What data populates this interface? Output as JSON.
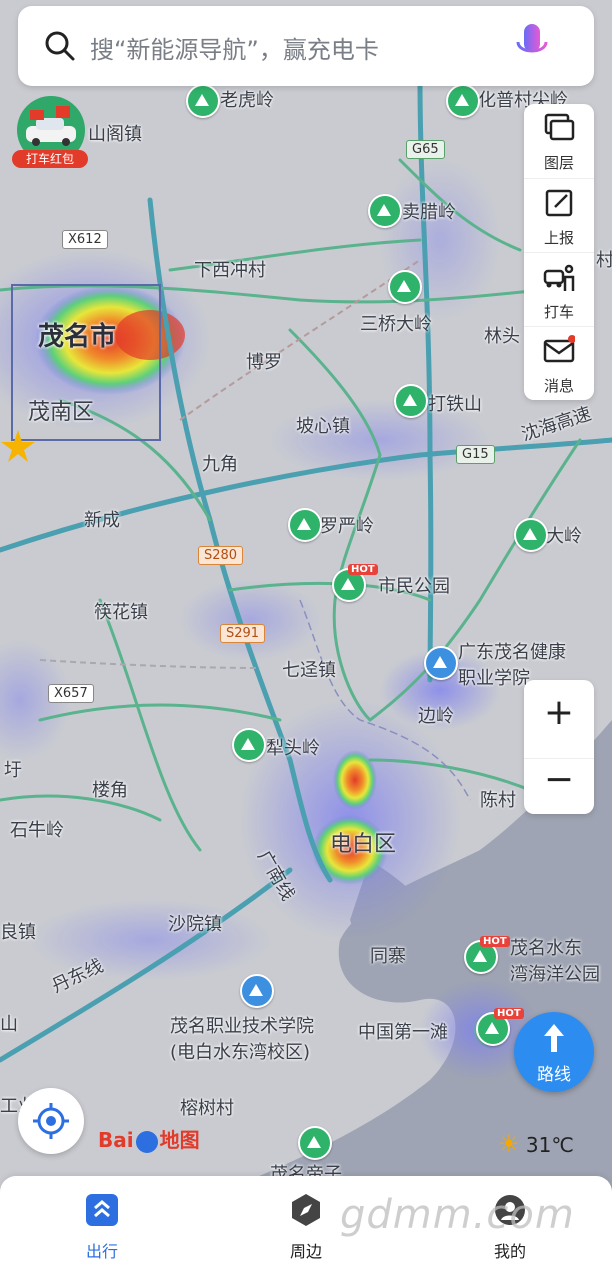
{
  "search": {
    "placeholder_text": "搜“新能源导航”，赢充电卡"
  },
  "redpack": {
    "label": "打车红包"
  },
  "tools": [
    {
      "label": "图层",
      "icon": "layers-icon"
    },
    {
      "label": "上报",
      "icon": "report-icon"
    },
    {
      "label": "打车",
      "icon": "taxi-icon"
    },
    {
      "label": "消息",
      "icon": "message-icon"
    }
  ],
  "zoom": {
    "in": "+",
    "out": "−"
  },
  "route": {
    "label": "路线"
  },
  "weather": {
    "temp": "31℃"
  },
  "logo": {
    "text": "Bai",
    "text2": "地图"
  },
  "watermark": "gdmm.com",
  "nav": [
    {
      "label": "出行",
      "icon": "travel-icon",
      "active": true
    },
    {
      "label": "周边",
      "icon": "compass-icon",
      "active": false
    },
    {
      "label": "我的",
      "icon": "profile-icon",
      "active": false
    }
  ],
  "map_labels": {
    "maoming": "茂名市",
    "maonan": "茂南区",
    "dianbai": "电白区",
    "laohuling": "老虎岭",
    "huapu": "化普村尖岭",
    "shange": "山阁镇",
    "maila": "卖腊岭",
    "xiaxichong": "下西冲村",
    "sanqiao": "三桥大岭",
    "linto": "林头",
    "cun": "村",
    "boluo": "博罗",
    "poxin": "坡心镇",
    "datie": "打铁山",
    "shenhai": "沈海高速",
    "jiujiao": "九角",
    "xincheng": "新成",
    "luoyan": "罗严岭",
    "shimin": "市民公园",
    "daling": "大岭",
    "kuaihua": "筷花镇",
    "qijing": "七迳镇",
    "gd_health": "广东茂名健康",
    "gd_health2": "职业学院",
    "bianling": "边岭",
    "xitou": "犁头岭",
    "chencun": "陈村",
    "loujiao": "楼角",
    "yugan": "圩",
    "shiniu": "石牛岭",
    "guangnan": "广南线",
    "shayuan": "沙院镇",
    "liangzhen": "良镇",
    "tongsai": "同寨",
    "maoming_shuidong": "茂名水东",
    "bay_park": "湾海洋公园",
    "dandong": "丹东线",
    "vocational": "茂名职业技术学院",
    "vocational2": "(电白水东湾校区)",
    "first_beach": "中国第一滩",
    "gongye": "工业",
    "rongshu": "榕树村",
    "dizi": "茂名帝子",
    "shan": "山"
  },
  "roads": {
    "x612": "X612",
    "g65": "G65",
    "g15": "G15",
    "s280": "S280",
    "s291": "S291",
    "x657": "X657"
  },
  "hot": "HOT"
}
